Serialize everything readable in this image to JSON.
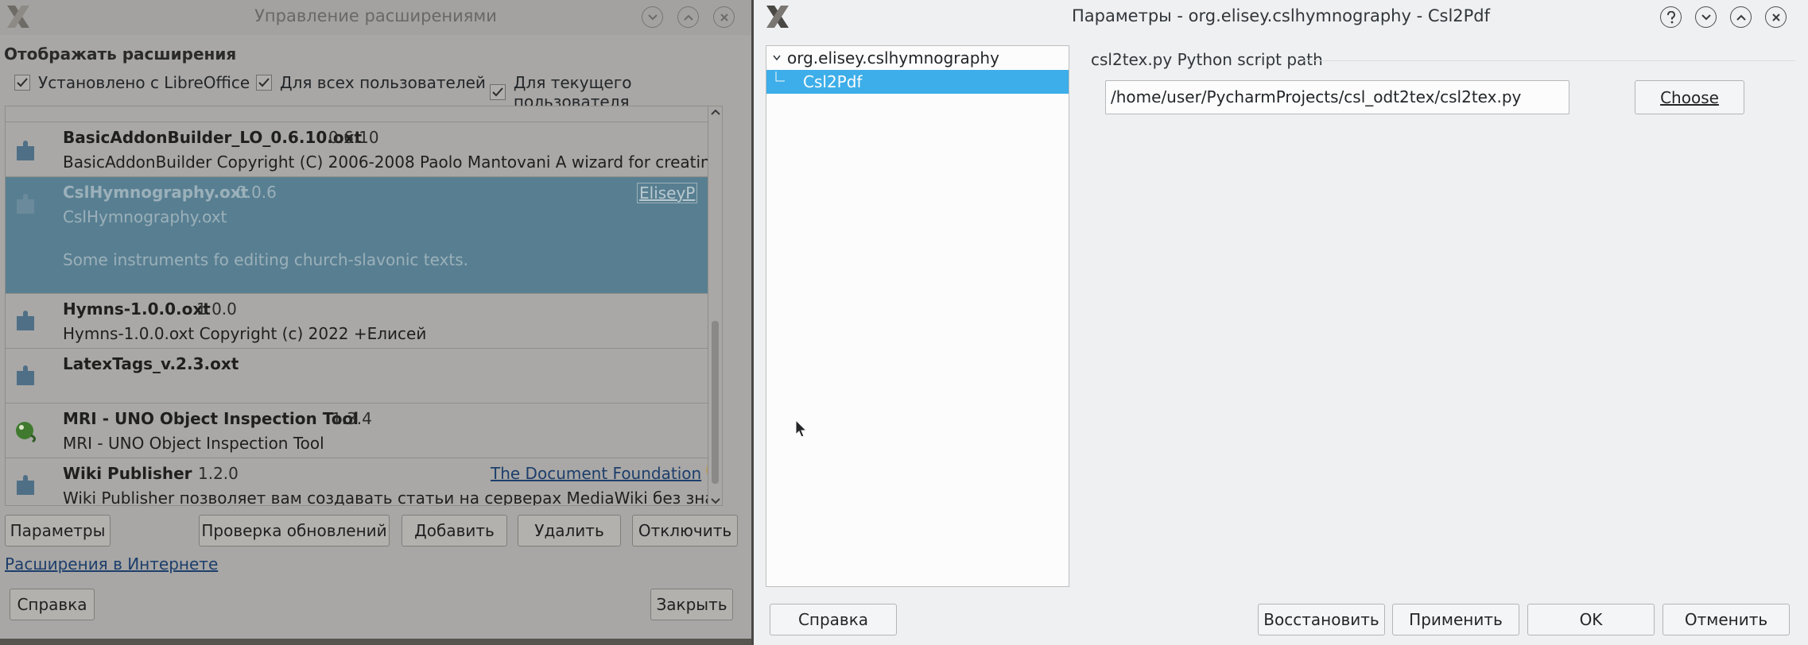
{
  "left_window": {
    "title": "Управление расширениями",
    "filter_group_label": "Отображать расширения",
    "filters": [
      {
        "label": "Установлено с LibreOffice",
        "checked": true
      },
      {
        "label": "Для всех пользователей",
        "checked": true
      },
      {
        "label": "Для текущего пользователя",
        "checked": true
      }
    ],
    "extensions": [
      {
        "name": "BasicAddonBuilder_LO_0.6.10.oxt",
        "version": "0.6.10",
        "description": "BasicAddonBuilder Copyright (C) 2006-2008 Paolo Mantovani  A wizard for creating Ope...",
        "icon": "puzzle-piece-icon"
      },
      {
        "name": "CslHymnography.oxt",
        "version": "0.0.6",
        "description": "CslHymnography.oxt",
        "extra": "Some instruments fo editing church-slavonic texts.",
        "publisher": "EliseyP",
        "selected": true,
        "icon": "puzzle-piece-icon"
      },
      {
        "name": "Hymns-1.0.0.oxt",
        "version": "1.0.0",
        "description": "Hymns-1.0.0.oxt Copyright (c) 2022 +Елисей",
        "icon": "puzzle-piece-icon"
      },
      {
        "name": "LatexTags_v.2.3.oxt",
        "version": "",
        "description": "",
        "icon": "puzzle-piece-icon"
      },
      {
        "name": "MRI - UNO Object Inspection Tool",
        "version": "1.3.4",
        "description": "MRI - UNO Object Inspection Tool",
        "icon": "mri-chameleon-icon"
      },
      {
        "name": "Wiki Publisher",
        "version": "1.2.0",
        "description": "Wiki Publisher позволяет вам создавать статьи на серверах MediaWiki без знания я...",
        "publisher": "The Document Foundation",
        "locked": true,
        "icon": "puzzle-piece-icon"
      }
    ],
    "buttons": {
      "options": "Параметры",
      "check_updates": "Проверка обновлений",
      "add": "Добавить",
      "remove": "Удалить",
      "disable": "Отключить",
      "help": "Справка",
      "close": "Закрыть"
    },
    "web_link": "Расширения в Интернете"
  },
  "right_window": {
    "title": "Параметры - org.elisey.cslhymnography - Csl2Pdf",
    "tree": {
      "root": "org.elisey.cslhymnography",
      "child": "Csl2Pdf"
    },
    "section_label": "csl2tex.py Python script path",
    "path_value": "/home/user/PycharmProjects/csl_odt2tex/csl2tex.py",
    "choose_button": "Choose",
    "buttons": {
      "help": "Справка",
      "reset": "Восстановить",
      "apply": "Применить",
      "ok": "OK",
      "cancel": "Отменить"
    },
    "selection_color": "#3daee9"
  }
}
